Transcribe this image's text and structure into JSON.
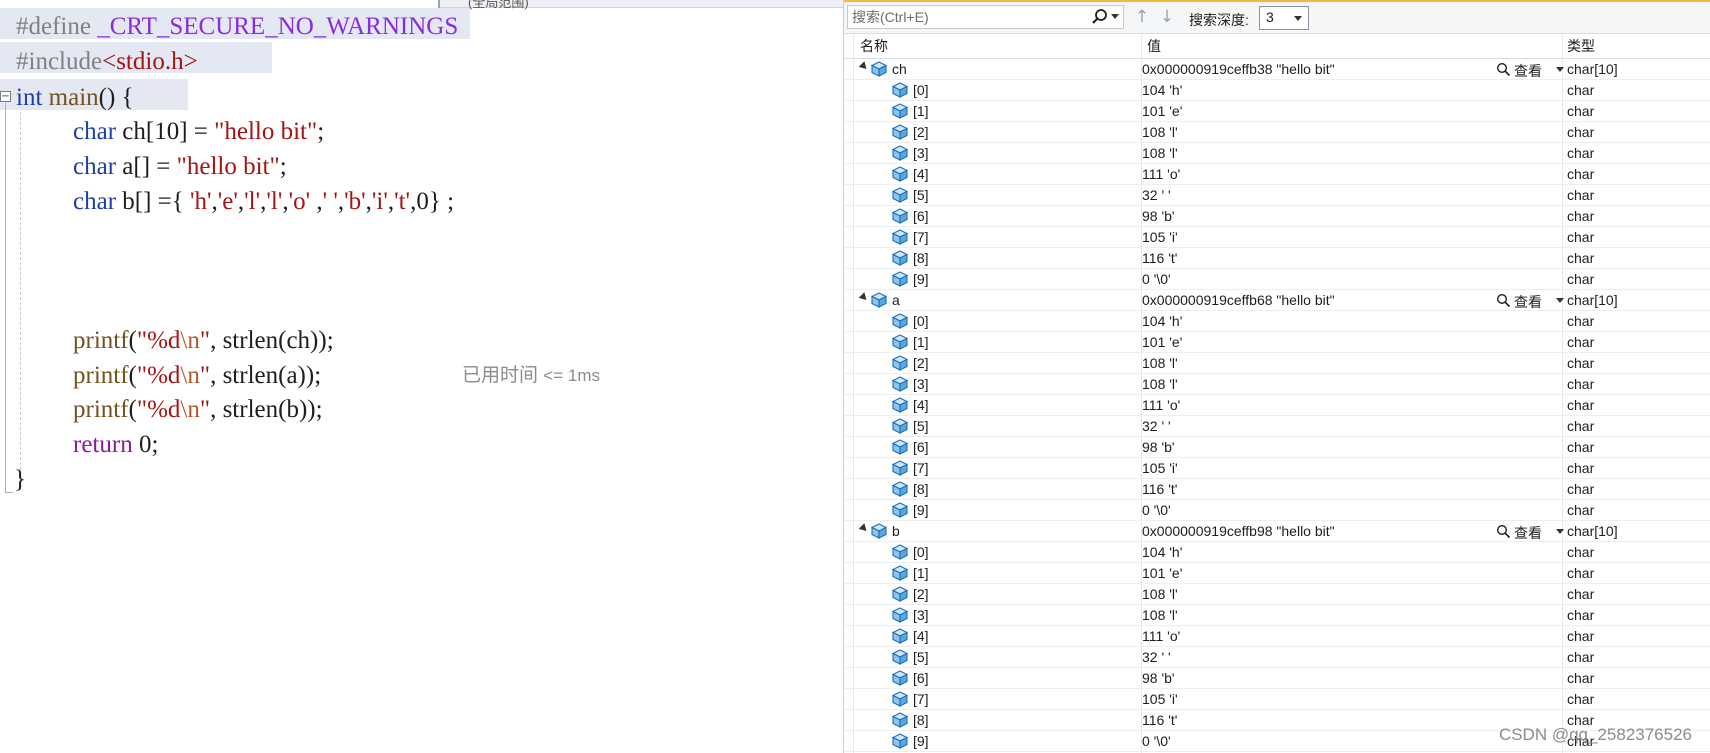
{
  "editor": {
    "tab_hint": "(全局范围)",
    "code": {
      "l1_pp": "#define",
      "l1_macro": "_CRT_SECURE_NO_WARNINGS",
      "l2_pp": "#include",
      "l2_hdr": "<stdio.h>",
      "l3_kw": "int",
      "l3_fn": "main",
      "l3_rest": "() {",
      "l4_kw": "char",
      "l4_a": " ch[",
      "l4_num": "10",
      "l4_b": "] = ",
      "l4_str": "\"hello bit\"",
      "l4_end": ";",
      "l5_kw": "char",
      "l5_a": " a[] = ",
      "l5_str": "\"hello bit\"",
      "l5_end": ";",
      "l6_kw": "char",
      "l6_a": " b[] ={ ",
      "l6_chars": [
        "'h'",
        "'e'",
        "'l'",
        "'l'",
        "'o'",
        "' '",
        "'b'",
        "'i'",
        "'t'"
      ],
      "l6_tail": ",0} ;",
      "pf_fn": "printf",
      "pf_open": "(",
      "pf_s1": "\"%d",
      "pf_esc": "\\n",
      "pf_s2": "\"",
      "pf_comma": ", ",
      "strlen_fn": "strlen",
      "arg_ch": "(ch));",
      "arg_a": "(a));",
      "arg_b": "(b));",
      "ret_kw": "return",
      "ret_val": " 0;",
      "close": "}"
    },
    "perf_tip": "已用时间",
    "perf_value": "<= 1ms"
  },
  "watch": {
    "search_placeholder": "搜索(Ctrl+E)",
    "depth_label": "搜索深度:",
    "depth_value": "3",
    "columns": {
      "name": "名称",
      "value": "值",
      "type": "类型"
    },
    "look_label": "查看",
    "groups": [
      {
        "name": "ch",
        "value": "0x000000919ceffb38 \"hello bit\"",
        "type": "char[10]",
        "children": [
          {
            "name": "[0]",
            "value": "104 'h'",
            "type": "char"
          },
          {
            "name": "[1]",
            "value": "101 'e'",
            "type": "char"
          },
          {
            "name": "[2]",
            "value": "108 'l'",
            "type": "char"
          },
          {
            "name": "[3]",
            "value": "108 'l'",
            "type": "char"
          },
          {
            "name": "[4]",
            "value": "111 'o'",
            "type": "char"
          },
          {
            "name": "[5]",
            "value": "32 ' '",
            "type": "char"
          },
          {
            "name": "[6]",
            "value": "98 'b'",
            "type": "char"
          },
          {
            "name": "[7]",
            "value": "105 'i'",
            "type": "char"
          },
          {
            "name": "[8]",
            "value": "116 't'",
            "type": "char"
          },
          {
            "name": "[9]",
            "value": "0 '\\0'",
            "type": "char"
          }
        ]
      },
      {
        "name": "a",
        "value": "0x000000919ceffb68 \"hello bit\"",
        "type": "char[10]",
        "children": [
          {
            "name": "[0]",
            "value": "104 'h'",
            "type": "char"
          },
          {
            "name": "[1]",
            "value": "101 'e'",
            "type": "char"
          },
          {
            "name": "[2]",
            "value": "108 'l'",
            "type": "char"
          },
          {
            "name": "[3]",
            "value": "108 'l'",
            "type": "char"
          },
          {
            "name": "[4]",
            "value": "111 'o'",
            "type": "char"
          },
          {
            "name": "[5]",
            "value": "32 ' '",
            "type": "char"
          },
          {
            "name": "[6]",
            "value": "98 'b'",
            "type": "char"
          },
          {
            "name": "[7]",
            "value": "105 'i'",
            "type": "char"
          },
          {
            "name": "[8]",
            "value": "116 't'",
            "type": "char"
          },
          {
            "name": "[9]",
            "value": "0 '\\0'",
            "type": "char"
          }
        ]
      },
      {
        "name": "b",
        "value": "0x000000919ceffb98 \"hello bit\"",
        "type": "char[10]",
        "children": [
          {
            "name": "[0]",
            "value": "104 'h'",
            "type": "char"
          },
          {
            "name": "[1]",
            "value": "101 'e'",
            "type": "char"
          },
          {
            "name": "[2]",
            "value": "108 'l'",
            "type": "char"
          },
          {
            "name": "[3]",
            "value": "108 'l'",
            "type": "char"
          },
          {
            "name": "[4]",
            "value": "111 'o'",
            "type": "char"
          },
          {
            "name": "[5]",
            "value": "32 ' '",
            "type": "char"
          },
          {
            "name": "[6]",
            "value": "98 'b'",
            "type": "char"
          },
          {
            "name": "[7]",
            "value": "105 'i'",
            "type": "char"
          },
          {
            "name": "[8]",
            "value": "116 't'",
            "type": "char"
          },
          {
            "name": "[9]",
            "value": "0 '\\0'",
            "type": "char"
          }
        ]
      }
    ]
  },
  "watermark": "CSDN @qq_2582376526",
  "icons": {
    "variable": "variable-cube-icon",
    "search": "search-icon",
    "look": "magnifier-icon"
  }
}
